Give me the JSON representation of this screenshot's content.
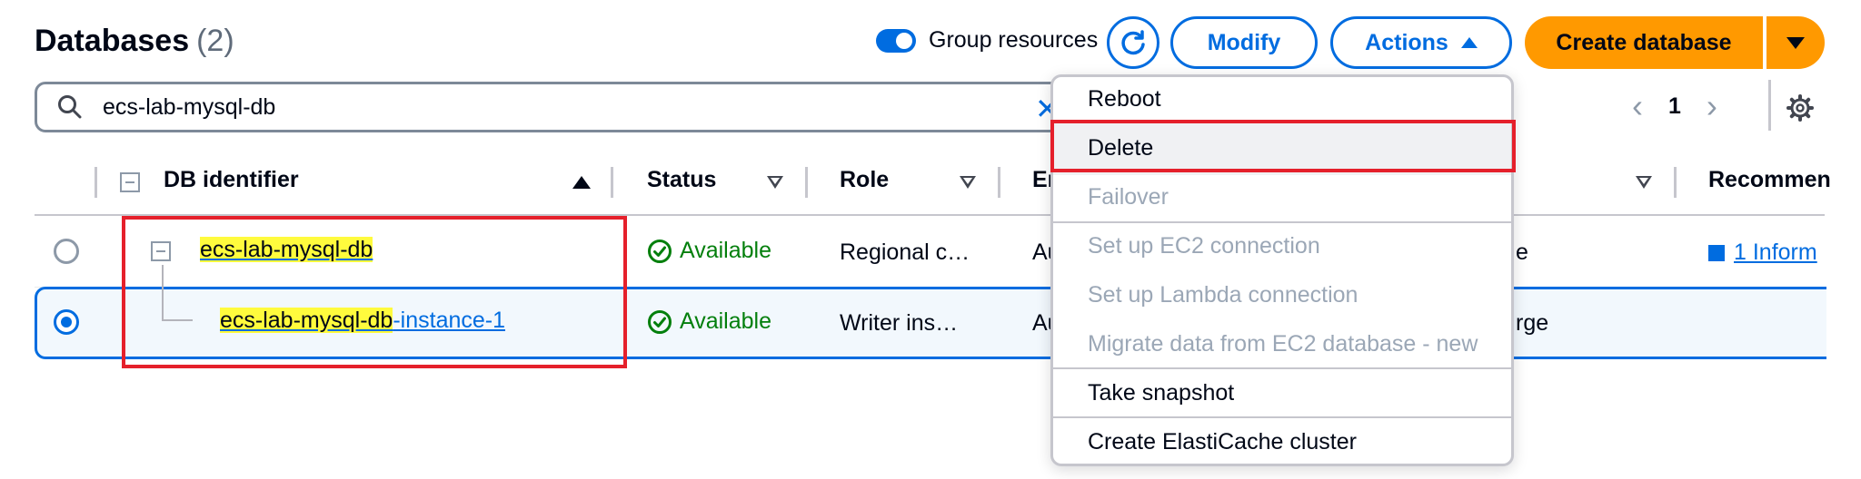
{
  "header": {
    "title": "Databases",
    "count": "(2)",
    "group_toggle_label": "Group resources",
    "modify_label": "Modify",
    "actions_label": "Actions",
    "create_label": "Create database"
  },
  "search": {
    "value": "ecs-lab-mysql-db",
    "clear_glyph": "✕"
  },
  "pagination": {
    "page": "1",
    "prev_glyph": "‹",
    "next_glyph": "›"
  },
  "columns": {
    "db_identifier": "DB identifier",
    "status": "Status",
    "role": "Role",
    "engine_partial": "En",
    "recommendations_partial": "Recommen"
  },
  "rows": [
    {
      "id_highlight": "ecs-lab-mysql-db",
      "id_rest": "",
      "status": "Available",
      "role": "Regional c…",
      "engine_partial": "Au",
      "size_partial": "e",
      "recommendation": "1 Inform"
    },
    {
      "id_highlight": "ecs-lab-mysql-db",
      "id_rest": "-instance-1",
      "status": "Available",
      "role": "Writer ins…",
      "engine_partial": "Au",
      "size_partial": "rge"
    }
  ],
  "actions_menu": {
    "items": [
      "Reboot",
      "Delete",
      "Failover",
      "Set up EC2 connection",
      "Set up Lambda connection",
      "Migrate data from EC2 database - new",
      "Take snapshot",
      "Create ElastiCache cluster"
    ]
  },
  "colors": {
    "accent": "#006ce0",
    "primary_button": "#ff9900",
    "status_ok": "#037f0c",
    "highlight": "#fffb3d",
    "annotation_red": "#e5202b"
  }
}
